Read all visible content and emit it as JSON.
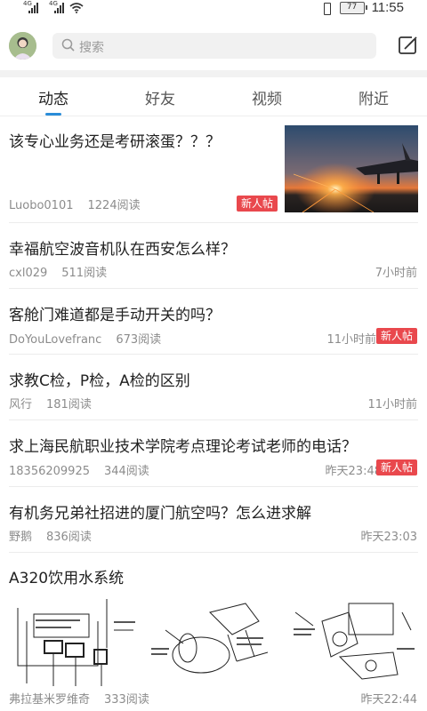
{
  "status": {
    "signal1": "4G",
    "signal2": "4G",
    "battery": "77",
    "time": "11:55"
  },
  "search": {
    "placeholder": "搜索"
  },
  "tabs": [
    {
      "label": "动态"
    },
    {
      "label": "好友"
    },
    {
      "label": "视频"
    },
    {
      "label": "附近"
    }
  ],
  "feed": [
    {
      "title": "该专心业务还是考研滚蛋？？？",
      "author": "Luobo0101",
      "reads": "1224阅读",
      "time": "",
      "badge": "新人帖"
    },
    {
      "title": "幸福航空波音机队在西安怎么样？",
      "author": "cxl029",
      "reads": "511阅读",
      "time": "7小时前",
      "badge": ""
    },
    {
      "title": "客舱门难道都是手动开关的吗？",
      "author": "DoYouLovefranc",
      "reads": "673阅读",
      "time": "11小时前",
      "badge": "新人帖"
    },
    {
      "title": "求教C检，P检，A检的区别",
      "author": "风行",
      "reads": "181阅读",
      "time": "11小时前",
      "badge": ""
    },
    {
      "title": "求上海民航职业技术学院考点理论考试老师的电话？",
      "author": "18356209925",
      "reads": "344阅读",
      "time": "昨天23:48",
      "badge": "新人帖"
    },
    {
      "title": "有机务兄弟社招进的厦门航空吗？怎么进求解",
      "author": "野鹅",
      "reads": "836阅读",
      "time": "昨天23:03",
      "badge": ""
    },
    {
      "title": "A320饮用水系统",
      "author": "弗拉基米罗维奇",
      "reads": "333阅读",
      "time": "昨天22:44",
      "badge": ""
    }
  ],
  "colors": {
    "accent": "#2a8cd8",
    "badge": "#e9484d"
  }
}
